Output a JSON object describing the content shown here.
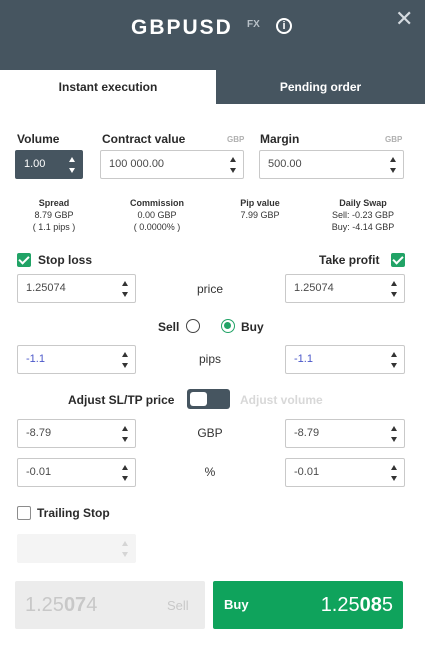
{
  "header": {
    "symbol": "GBPUSD",
    "badge": "FX",
    "info_glyph": "i",
    "close_glyph": "✕"
  },
  "tabs": [
    {
      "label": "Instant execution",
      "active": true
    },
    {
      "label": "Pending order",
      "active": false
    }
  ],
  "volume": {
    "label": "Volume",
    "value": "1.00"
  },
  "contract_value": {
    "label": "Contract value",
    "unit": "GBP",
    "value": "100 000.00"
  },
  "margin": {
    "label": "Margin",
    "unit": "GBP",
    "value": "500.00"
  },
  "stats": {
    "spread": {
      "label": "Spread",
      "line1": "8.79 GBP",
      "line2": "( 1.1 pips )"
    },
    "commission": {
      "label": "Commission",
      "line1": "0.00 GBP",
      "line2": "( 0.0000% )"
    },
    "pip_value": {
      "label": "Pip value",
      "line1": "7.99 GBP"
    },
    "daily_swap": {
      "label": "Daily Swap",
      "line1": "Sell: -0.23 GBP",
      "line2": "Buy: -4.14 GBP"
    }
  },
  "stop_loss": {
    "label": "Stop loss",
    "checked": true,
    "price": "1.25074",
    "pips": "-1.1",
    "gbp": "-8.79",
    "percent": "-0.01"
  },
  "take_profit": {
    "label": "Take profit",
    "checked": true,
    "price": "1.25074",
    "pips": "-1.1",
    "gbp": "-8.79",
    "percent": "-0.01"
  },
  "row_labels": {
    "price": "price",
    "pips": "pips",
    "gbp": "GBP",
    "percent": "%"
  },
  "direction": {
    "sell_label": "Sell",
    "buy_label": "Buy",
    "selected": "Buy"
  },
  "adjust": {
    "sltp_label": "Adjust SL/TP price",
    "volume_label": "Adjust volume"
  },
  "trailing_stop": {
    "label": "Trailing Stop",
    "checked": false,
    "value": ""
  },
  "sell_button": {
    "label": "Sell",
    "price_prefix": "1.25",
    "price_big": "07",
    "price_suffix": "4"
  },
  "buy_button": {
    "label": "Buy",
    "price_prefix": "1.25",
    "price_big": "08",
    "price_suffix": "5"
  },
  "colors": {
    "header_bg": "#465560",
    "accent_green": "#21a366",
    "buy_button": "#0fa35c",
    "pips_text": "#4a57c9"
  }
}
